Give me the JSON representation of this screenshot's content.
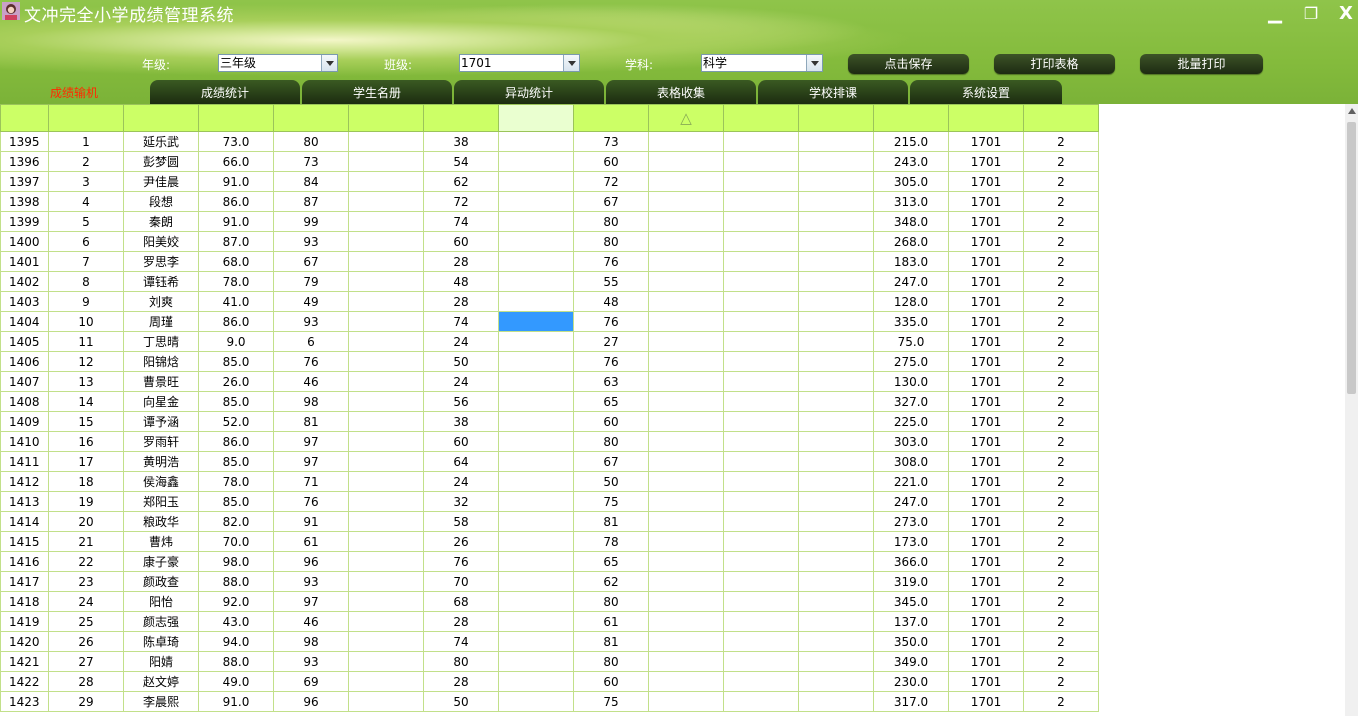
{
  "app": {
    "title": "文冲完全小学成绩管理系统"
  },
  "window": {
    "minimize": "▁",
    "restore": "❐",
    "close": "X"
  },
  "filters": {
    "grade_label": "年级:",
    "grade_value": "三年级",
    "class_label": "班级:",
    "class_value": "1701",
    "subject_label": "学科:",
    "subject_value": "科学"
  },
  "actions": {
    "save": "点击保存",
    "print_table": "打印表格",
    "batch_print": "批量打印"
  },
  "tabs": [
    "成绩输机",
    "成绩统计",
    "学生名册",
    "异动统计",
    "表格收集",
    "学校排课",
    "系统设置"
  ],
  "grid": {
    "sort_indicator": "△",
    "rows": [
      [
        "1395",
        "1",
        "延乐武",
        "73.0",
        "80",
        "",
        "38",
        "",
        "73",
        "",
        "",
        "",
        "215.0",
        "1701",
        "2"
      ],
      [
        "1396",
        "2",
        "彭梦圆",
        "66.0",
        "73",
        "",
        "54",
        "",
        "60",
        "",
        "",
        "",
        "243.0",
        "1701",
        "2"
      ],
      [
        "1397",
        "3",
        "尹佳晨",
        "91.0",
        "84",
        "",
        "62",
        "",
        "72",
        "",
        "",
        "",
        "305.0",
        "1701",
        "2"
      ],
      [
        "1398",
        "4",
        "段想",
        "86.0",
        "87",
        "",
        "72",
        "",
        "67",
        "",
        "",
        "",
        "313.0",
        "1701",
        "2"
      ],
      [
        "1399",
        "5",
        "秦朗",
        "91.0",
        "99",
        "",
        "74",
        "",
        "80",
        "",
        "",
        "",
        "348.0",
        "1701",
        "2"
      ],
      [
        "1400",
        "6",
        "阳美姣",
        "87.0",
        "93",
        "",
        "60",
        "",
        "80",
        "",
        "",
        "",
        "268.0",
        "1701",
        "2"
      ],
      [
        "1401",
        "7",
        "罗思李",
        "68.0",
        "67",
        "",
        "28",
        "",
        "76",
        "",
        "",
        "",
        "183.0",
        "1701",
        "2"
      ],
      [
        "1402",
        "8",
        "谭钰希",
        "78.0",
        "79",
        "",
        "48",
        "",
        "55",
        "",
        "",
        "",
        "247.0",
        "1701",
        "2"
      ],
      [
        "1403",
        "9",
        "刘爽",
        "41.0",
        "49",
        "",
        "28",
        "",
        "48",
        "",
        "",
        "",
        "128.0",
        "1701",
        "2"
      ],
      [
        "1404",
        "10",
        "周瑾",
        "86.0",
        "93",
        "",
        "74",
        "",
        "76",
        "",
        "",
        "",
        "335.0",
        "1701",
        "2"
      ],
      [
        "1405",
        "11",
        "丁思晴",
        "9.0",
        "6",
        "",
        "24",
        "",
        "27",
        "",
        "",
        "",
        "75.0",
        "1701",
        "2"
      ],
      [
        "1406",
        "12",
        "阳锦焓",
        "85.0",
        "76",
        "",
        "50",
        "",
        "76",
        "",
        "",
        "",
        "275.0",
        "1701",
        "2"
      ],
      [
        "1407",
        "13",
        "曹景旺",
        "26.0",
        "46",
        "",
        "24",
        "",
        "63",
        "",
        "",
        "",
        "130.0",
        "1701",
        "2"
      ],
      [
        "1408",
        "14",
        "向星金",
        "85.0",
        "98",
        "",
        "56",
        "",
        "65",
        "",
        "",
        "",
        "327.0",
        "1701",
        "2"
      ],
      [
        "1409",
        "15",
        "谭予涵",
        "52.0",
        "81",
        "",
        "38",
        "",
        "60",
        "",
        "",
        "",
        "225.0",
        "1701",
        "2"
      ],
      [
        "1410",
        "16",
        "罗雨轩",
        "86.0",
        "97",
        "",
        "60",
        "",
        "80",
        "",
        "",
        "",
        "303.0",
        "1701",
        "2"
      ],
      [
        "1411",
        "17",
        "黄明浩",
        "85.0",
        "97",
        "",
        "64",
        "",
        "67",
        "",
        "",
        "",
        "308.0",
        "1701",
        "2"
      ],
      [
        "1412",
        "18",
        "侯海鑫",
        "78.0",
        "71",
        "",
        "24",
        "",
        "50",
        "",
        "",
        "",
        "221.0",
        "1701",
        "2"
      ],
      [
        "1413",
        "19",
        "郑阳玉",
        "85.0",
        "76",
        "",
        "32",
        "",
        "75",
        "",
        "",
        "",
        "247.0",
        "1701",
        "2"
      ],
      [
        "1414",
        "20",
        "粮政华",
        "82.0",
        "91",
        "",
        "58",
        "",
        "81",
        "",
        "",
        "",
        "273.0",
        "1701",
        "2"
      ],
      [
        "1415",
        "21",
        "曹炜",
        "70.0",
        "61",
        "",
        "26",
        "",
        "78",
        "",
        "",
        "",
        "173.0",
        "1701",
        "2"
      ],
      [
        "1416",
        "22",
        "康子豪",
        "98.0",
        "96",
        "",
        "76",
        "",
        "65",
        "",
        "",
        "",
        "366.0",
        "1701",
        "2"
      ],
      [
        "1417",
        "23",
        "颜政查",
        "88.0",
        "93",
        "",
        "70",
        "",
        "62",
        "",
        "",
        "",
        "319.0",
        "1701",
        "2"
      ],
      [
        "1418",
        "24",
        "阳怡",
        "92.0",
        "97",
        "",
        "68",
        "",
        "80",
        "",
        "",
        "",
        "345.0",
        "1701",
        "2"
      ],
      [
        "1419",
        "25",
        "颜志强",
        "43.0",
        "46",
        "",
        "28",
        "",
        "61",
        "",
        "",
        "",
        "137.0",
        "1701",
        "2"
      ],
      [
        "1420",
        "26",
        "陈卓琦",
        "94.0",
        "98",
        "",
        "74",
        "",
        "81",
        "",
        "",
        "",
        "350.0",
        "1701",
        "2"
      ],
      [
        "1421",
        "27",
        "阳婧",
        "88.0",
        "93",
        "",
        "80",
        "",
        "80",
        "",
        "",
        "",
        "349.0",
        "1701",
        "2"
      ],
      [
        "1422",
        "28",
        "赵文婷",
        "49.0",
        "69",
        "",
        "28",
        "",
        "60",
        "",
        "",
        "",
        "230.0",
        "1701",
        "2"
      ],
      [
        "1423",
        "29",
        "李晨熙",
        "91.0",
        "96",
        "",
        "50",
        "",
        "75",
        "",
        "",
        "",
        "317.0",
        "1701",
        "2"
      ]
    ]
  },
  "colors": {
    "header_green": "#84bb3c",
    "grid_header": "#ccff66",
    "selection": "#3399ff",
    "active_tab_text": "#ff2a00"
  }
}
